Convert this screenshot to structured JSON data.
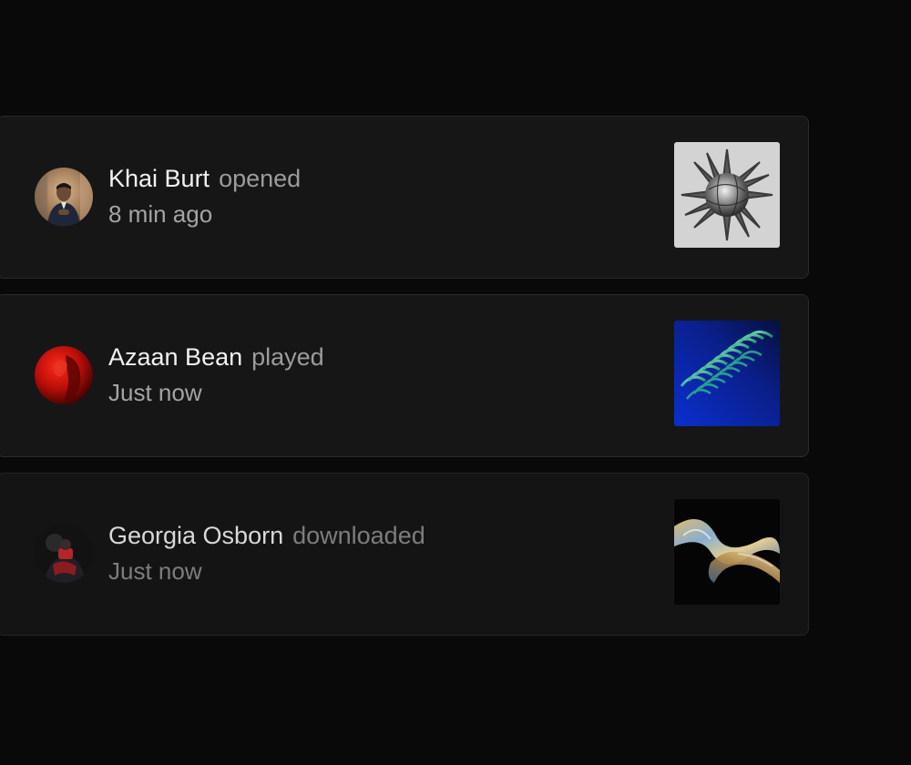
{
  "activity": [
    {
      "user": "Khai Burt",
      "action": "opened",
      "time": "8 min ago",
      "avatar_icon": "person-avatar",
      "thumbnail_icon": "spiky-sphere-artwork"
    },
    {
      "user": "Azaan Bean",
      "action": "played",
      "time": "Just now",
      "avatar_icon": "red-portrait-avatar",
      "thumbnail_icon": "green-ribbon-artwork"
    },
    {
      "user": "Georgia Osborn",
      "action": "downloaded",
      "time": "Just now",
      "avatar_icon": "dark-portrait-avatar",
      "thumbnail_icon": "chrome-swirl-artwork"
    }
  ],
  "colors": {
    "page_background": "#090909",
    "card_background": "#161616",
    "card_border": "#2b2b2b",
    "name_text": "#f2f2f2",
    "secondary_text": "#9c9c9c"
  }
}
